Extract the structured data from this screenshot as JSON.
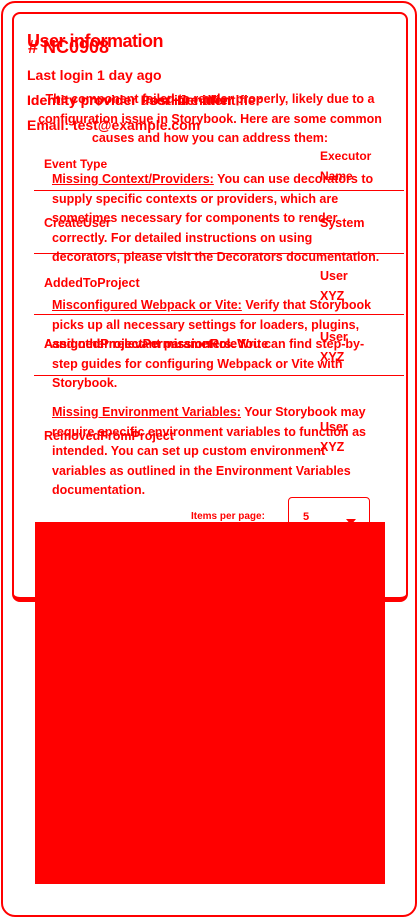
{
  "user_info": {
    "ghost_title": "# NC0908",
    "title": "User information",
    "last_login": "Last login 1 day ago",
    "identity_provider_label": "Identity provider user identifier",
    "identity_provider_ghost": "Identity provider PostHire identifier",
    "email": "Email: test@example.com"
  },
  "error_overlay": {
    "intro": "The component failed to render properly, likely due to a configuration issue in Storybook. Here are some common causes and how you can address them:",
    "items": [
      {
        "title": "Missing Context/Providers:",
        "text": "You can use decorators to supply specific contexts or providers, which are sometimes necessary for components to render correctly. For detailed instructions on using decorators, please visit the Decorators documentation."
      },
      {
        "title": "Misconfigured Webpack or Vite:",
        "text": "Verify that Storybook picks up all necessary settings for loaders, plugins, and other relevant parameters. You can find step-by-step guides for configuring Webpack or Vite with Storybook."
      },
      {
        "title": "Missing Environment Variables:",
        "text": "Your Storybook may require specific environment variables to function as intended. You can set up custom environment variables as outlined in the Environment Variables documentation."
      }
    ]
  },
  "table": {
    "headers": {
      "event_type": "Event Type",
      "executor": "Executor Name"
    },
    "rows": [
      {
        "event": "CreateUser",
        "executor": "System"
      },
      {
        "event": "AddedToProject",
        "executor": "User XYZ"
      },
      {
        "event": "AssignedProjectPermissionRole",
        "ghost_event": "AssignedProjectPermissionRoleWrite",
        "executor": "User XYZ"
      },
      {
        "event": "RemovedFromProject",
        "executor": "User XYZ"
      }
    ]
  },
  "pagination": {
    "items_per_page_label": "Items per page:",
    "items_per_page_value": "5"
  },
  "colors": {
    "accent": "#ff0000",
    "background": "#ffffff"
  }
}
